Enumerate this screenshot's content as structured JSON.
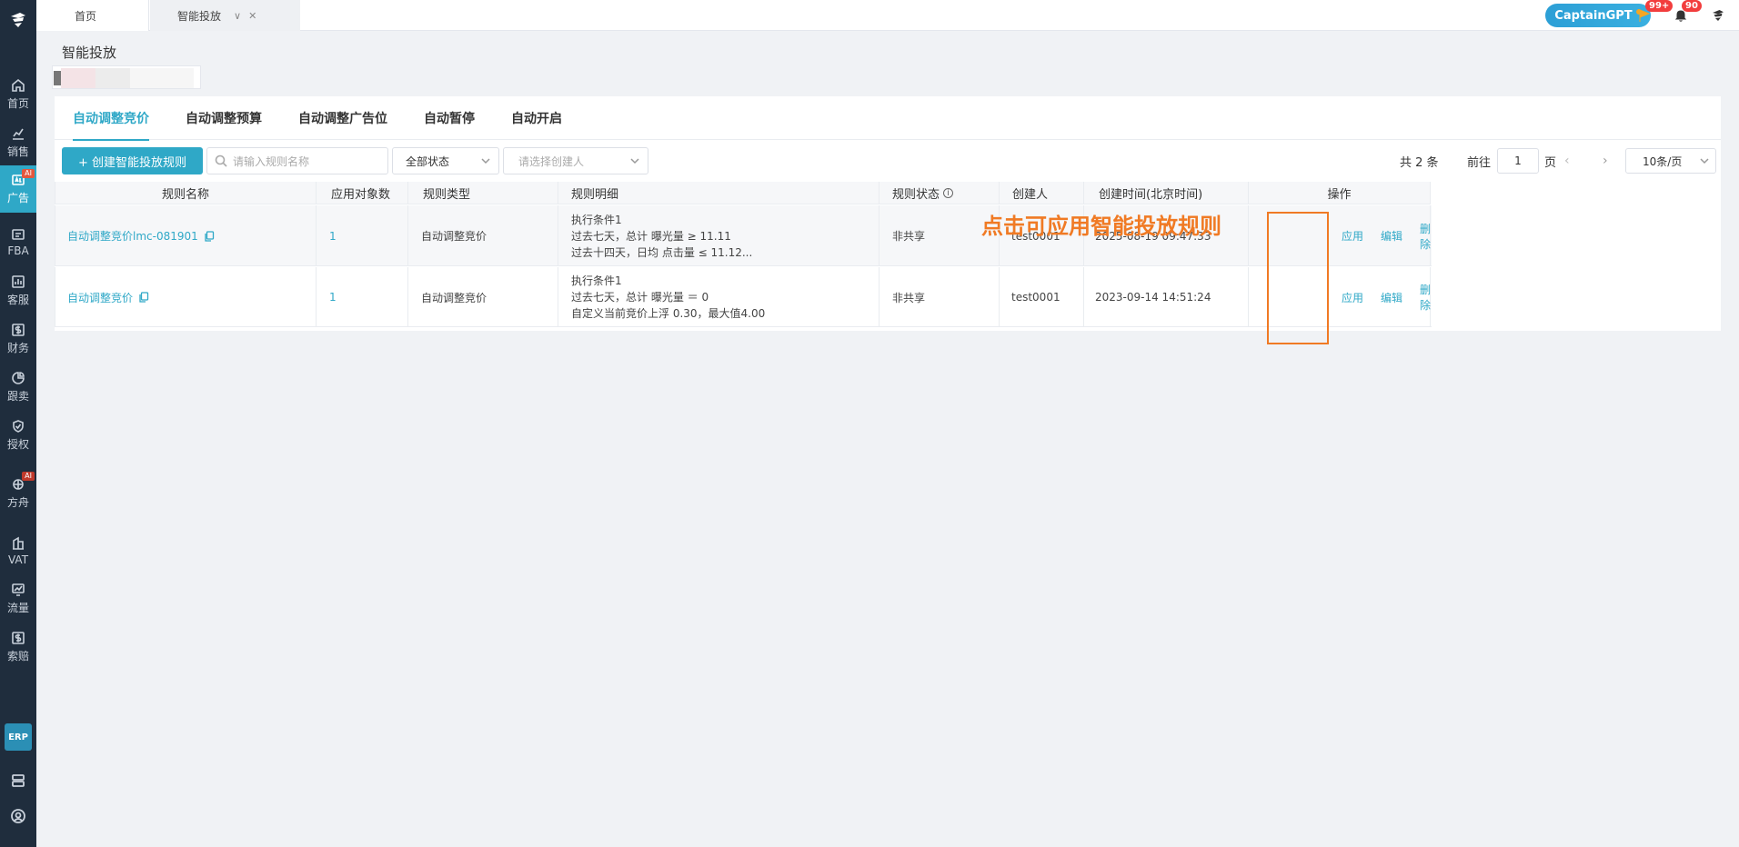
{
  "sidebar": {
    "items": [
      {
        "label": "首页",
        "icon": "home-icon",
        "active": false,
        "ai": false
      },
      {
        "label": "销售",
        "icon": "chart-icon",
        "active": false,
        "ai": false
      },
      {
        "label": "广告",
        "icon": "ad-icon",
        "active": true,
        "ai": true
      },
      {
        "label": "FBA",
        "icon": "box-icon",
        "active": false,
        "ai": false
      },
      {
        "label": "客服",
        "icon": "service-icon",
        "active": false,
        "ai": false
      },
      {
        "label": "财务",
        "icon": "finance-icon",
        "active": false,
        "ai": false
      },
      {
        "label": "跟卖",
        "icon": "pie-icon",
        "active": false,
        "ai": false
      },
      {
        "label": "授权",
        "icon": "shield-icon",
        "active": false,
        "ai": false
      },
      {
        "label": "方舟",
        "icon": "ark-icon",
        "active": false,
        "ai": true
      },
      {
        "label": "VAT",
        "icon": "building-icon",
        "active": false,
        "ai": false
      },
      {
        "label": "流量",
        "icon": "traffic-icon",
        "active": false,
        "ai": false
      },
      {
        "label": "索赔",
        "icon": "claim-icon",
        "active": false,
        "ai": false
      }
    ],
    "ai_tag": "AI",
    "erp_label": "ERP"
  },
  "topbar": {
    "tabs": [
      {
        "label": "首页"
      },
      {
        "label": "智能投放"
      }
    ],
    "captain_label": "CaptainGPT",
    "flag_badge": "99+",
    "bell_badge": "90"
  },
  "page": {
    "title": "智能投放"
  },
  "subtabs": [
    "自动调整竞价",
    "自动调整预算",
    "自动调整广告位",
    "自动暂停",
    "自动开启"
  ],
  "toolbar": {
    "create_label": "+ 创建智能投放规则",
    "search_placeholder": "请输入规则名称",
    "status_value": "全部状态",
    "creator_placeholder": "请选择创建人"
  },
  "pager": {
    "total": "共 2 条",
    "goto": "前往",
    "page_value": "1",
    "page_unit": "页",
    "page_size": "10条/页"
  },
  "table": {
    "headers": [
      "规则名称",
      "应用对象数",
      "规则类型",
      "规则明细",
      "规则状态",
      "创建人",
      "创建时间(北京时间)",
      "操作"
    ],
    "rows": [
      {
        "name": "自动调整竞价lmc-081901",
        "count": "1",
        "type": "自动调整竞价",
        "detail": [
          "执行条件1",
          "过去七天，总计  曝光量 ≥ 11.11",
          "过去十四天，日均  点击量 ≤ 11.12..."
        ],
        "status": "非共享",
        "creator": "test0001",
        "created": "2025-08-19 09:47:33"
      },
      {
        "name": "自动调整竞价",
        "count": "1",
        "type": "自动调整竞价",
        "detail": [
          "执行条件1",
          "过去七天，总计  曝光量 ＝ 0",
          "自定义当前竞价上浮 0.30，最大值4.00"
        ],
        "status": "非共享",
        "creator": "test0001",
        "created": "2023-09-14 14:51:24"
      }
    ],
    "ops": [
      "应用",
      "编辑",
      "删除"
    ]
  },
  "annotation": "点击可应用智能投放规则",
  "colors": {
    "accent": "#2fa8c7",
    "sidebar": "#1f2d3d",
    "annotation": "#f07a24"
  }
}
